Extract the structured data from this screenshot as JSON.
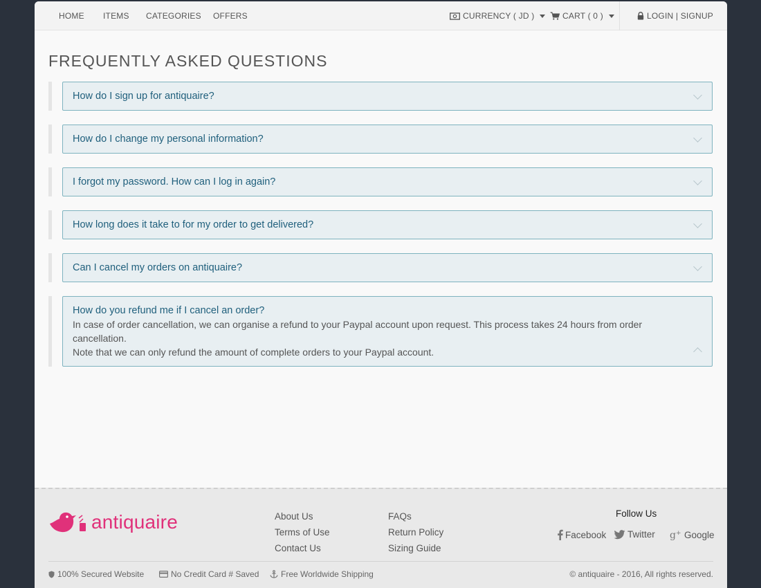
{
  "nav": {
    "home": "HOME",
    "items": "ITEMS",
    "categories": "CATEGORIES",
    "offers": "OFFERS",
    "currency": "CURRENCY ( JD )",
    "cart": "CART ( 0 )",
    "login": "LOGIN | SIGNUP"
  },
  "page_title": "FREQUENTLY ASKED QUESTIONS",
  "faqs": [
    {
      "question": "How do I sign up for antiquaire?"
    },
    {
      "question": "How do I change my personal information?"
    },
    {
      "question": "I forgot my password. How can I log in again?"
    },
    {
      "question": "How long does it take to for my order to get delivered?"
    },
    {
      "question": "Can I cancel my orders on antiquaire?"
    },
    {
      "question": "How do you refund me if I cancel an order?",
      "answer_line1": "In case of order cancellation, we can organise a refund to your Paypal account upon request. This process takes 24 hours from order cancellation.",
      "answer_line2": "Note that we can only refund the amount of complete orders to your Paypal account."
    }
  ],
  "footer": {
    "brand": "antiquaire",
    "col1": [
      "About Us",
      "Terms of Use",
      "Contact Us"
    ],
    "col2": [
      "FAQs",
      "Return Policy",
      "Sizing Guide"
    ],
    "follow_title": "Follow Us",
    "social": {
      "facebook": "Facebook",
      "twitter": "Twitter",
      "google": "Google"
    },
    "badges": {
      "secured": "100% Secured Website",
      "no_card": "No Credit Card # Saved",
      "shipping": "Free Worldwide Shipping"
    },
    "copyright": "© antiquaire - 2016, All rights reserved."
  },
  "colors": {
    "brand": "#e0317a",
    "question": "#1f5f7c",
    "faq_bg": "#e8eff2",
    "faq_border": "#7eb3bf",
    "background": "#2a313c"
  },
  "icons": [
    "currency-icon",
    "cart-icon",
    "lock-icon",
    "chevron-down-icon",
    "chevron-up-icon",
    "bird-logo-icon",
    "facebook-icon",
    "twitter-icon",
    "google-plus-icon",
    "shield-icon",
    "credit-card-icon",
    "anchor-icon"
  ]
}
